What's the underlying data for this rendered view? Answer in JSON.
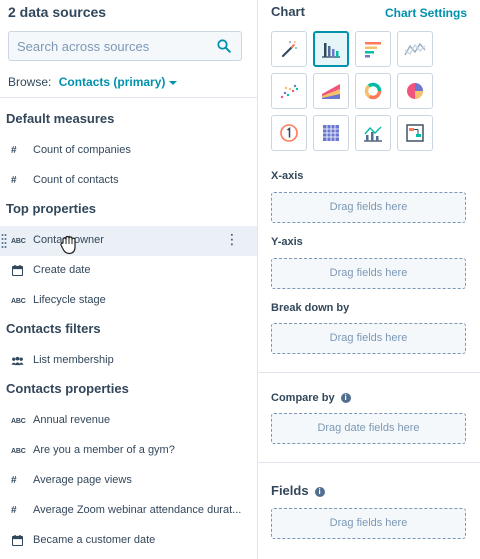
{
  "data_sources": {
    "title": "2 data sources",
    "search_placeholder": "Search across sources",
    "browse_label": "Browse:",
    "browse_value": "Contacts (primary)"
  },
  "sections": [
    {
      "title": "Default measures",
      "items": [
        {
          "icon": "#",
          "label": "Count of companies"
        },
        {
          "icon": "#",
          "label": "Count of contacts"
        }
      ]
    },
    {
      "title": "Top properties",
      "items": [
        {
          "icon": "ABC",
          "label": "Contact owner"
        },
        {
          "icon": "calendar",
          "label": "Create date"
        },
        {
          "icon": "ABC",
          "label": "Lifecycle stage"
        }
      ]
    },
    {
      "title": "Contacts filters",
      "items": [
        {
          "icon": "group",
          "label": "List membership"
        }
      ]
    },
    {
      "title": "Contacts properties",
      "items": [
        {
          "icon": "ABC",
          "label": "Annual revenue"
        },
        {
          "icon": "ABC",
          "label": "Are you a member of a gym?"
        },
        {
          "icon": "#",
          "label": "Average page views"
        },
        {
          "icon": "#",
          "label": "Average Zoom webinar attendance durat..."
        },
        {
          "icon": "calendar",
          "label": "Became a customer date"
        }
      ]
    }
  ],
  "icon_glyphs": {
    "hash": "#",
    "abc": "ABC",
    "more": "⋮"
  },
  "chart": {
    "title": "Chart",
    "settings_label": "Chart Settings",
    "x_axis_label": "X-axis",
    "x_axis_drop": "Drag fields here",
    "y_axis_label": "Y-axis",
    "y_axis_drop": "Drag fields here",
    "breakdown_label": "Break down by",
    "breakdown_drop": "Drag fields here",
    "compare_label": "Compare by",
    "compare_drop": "Drag date fields here",
    "fields_label": "Fields",
    "fields_drop": "Drag fields here",
    "info_glyph": "i",
    "types": [
      "magic-wand-icon",
      "vertical-bar-chart-icon",
      "horizontal-bar-chart-icon",
      "line-chart-icon",
      "scatter-chart-icon",
      "area-chart-icon",
      "donut-chart-icon",
      "pie-chart-icon",
      "summary-number-icon",
      "pivot-table-icon",
      "combination-chart-icon",
      "funnel-table-icon"
    ],
    "selected_type": "vertical-bar-chart-icon"
  },
  "colors": {
    "accent": "#0091ae",
    "text": "#33475b",
    "border": "#cbd6e2",
    "hover": "#eaf0f6",
    "orange": "#ff7a59",
    "teal": "#00bda5",
    "blue": "#516f90",
    "purple": "#6a78d1",
    "yellow": "#f5c26b",
    "pink": "#f2547d"
  }
}
